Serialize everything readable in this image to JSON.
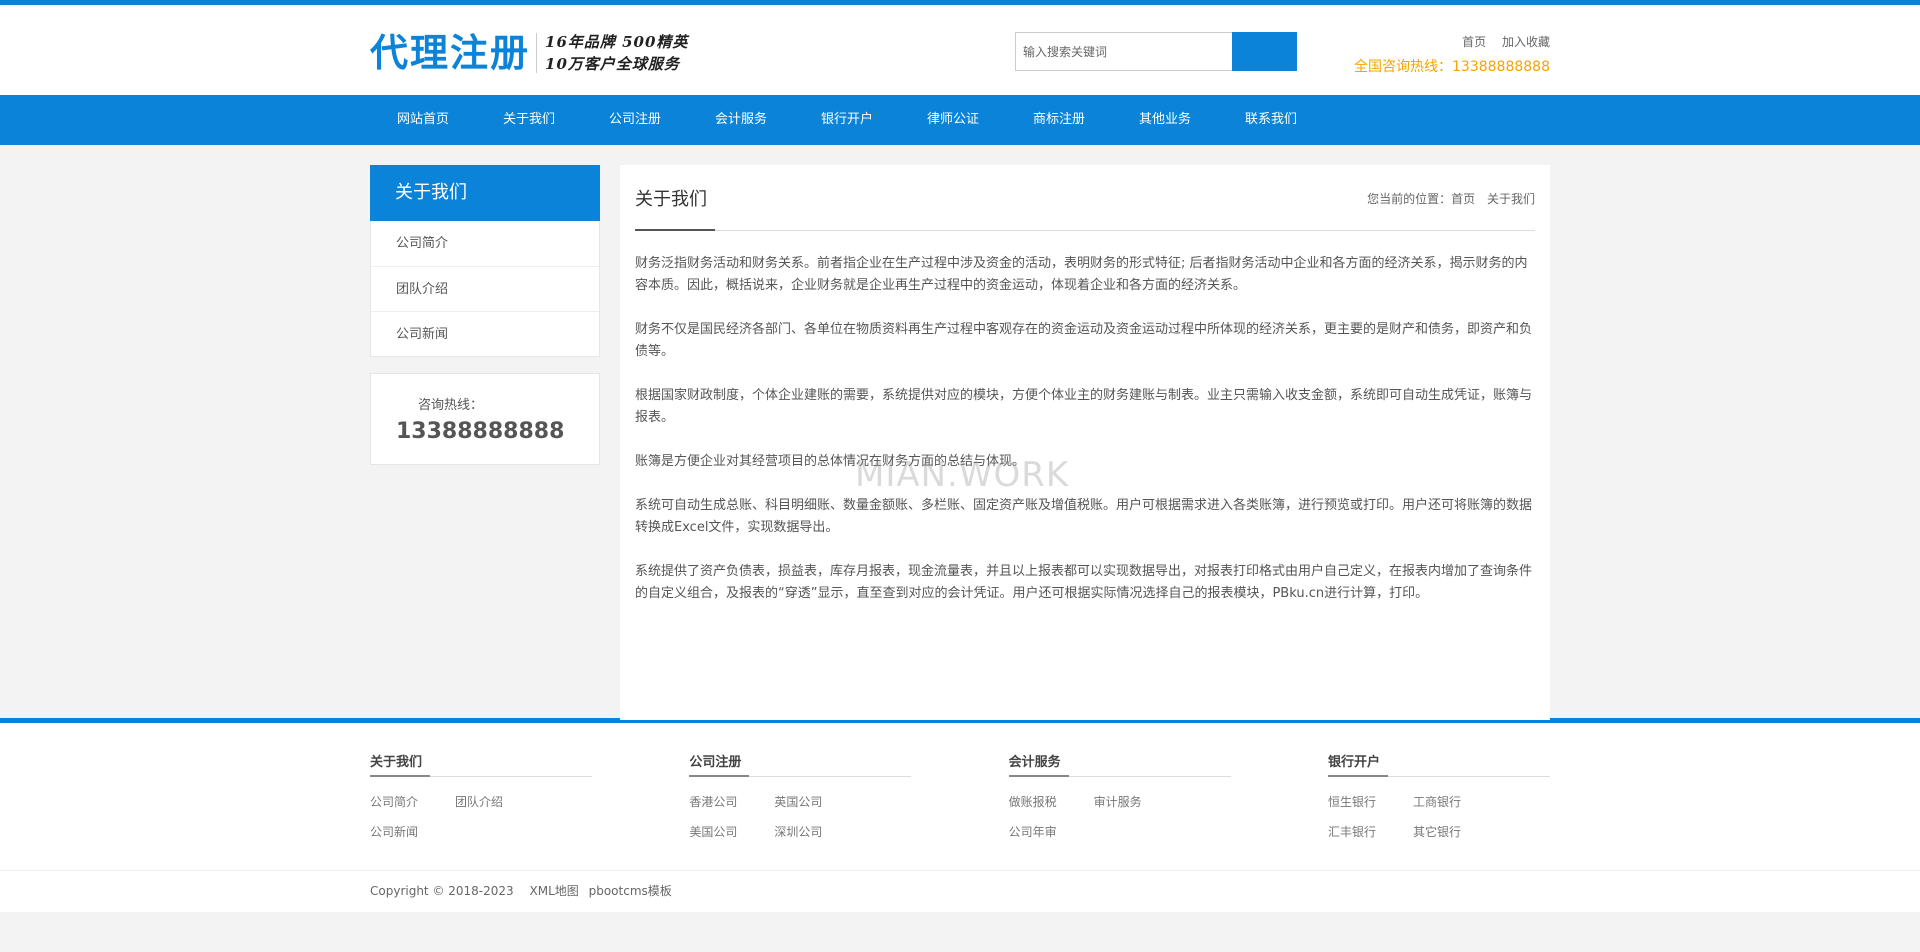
{
  "header": {
    "logo_text": "代理注册",
    "slogan_line1": "16年品牌 500精英",
    "slogan_line2": "10万客户全球服务",
    "search_placeholder": "输入搜索关键词",
    "links": [
      "首页",
      "加入收藏"
    ],
    "hotline": "全国咨询热线：13388888888"
  },
  "nav": {
    "items": [
      "网站首页",
      "关于我们",
      "公司注册",
      "会计服务",
      "银行开户",
      "律师公证",
      "商标注册",
      "其他业务",
      "联系我们"
    ]
  },
  "sidebar": {
    "title": "关于我们",
    "items": [
      "公司简介",
      "团队介绍",
      "公司新闻"
    ],
    "contact_label": "咨询热线：",
    "contact_phone": "13388888888"
  },
  "content": {
    "title": "关于我们",
    "breadcrumb_prefix": "您当前的位置：",
    "breadcrumb_home": "首页",
    "breadcrumb_current": "关于我们",
    "paragraphs": [
      "财务泛指财务活动和财务关系。前者指企业在生产过程中涉及资金的活动，表明财务的形式特征; 后者指财务活动中企业和各方面的经济关系，揭示财务的内容本质。因此，概括说来，企业财务就是企业再生产过程中的资金运动，体现着企业和各方面的经济关系。",
      "财务不仅是国民经济各部门、各单位在物质资料再生产过程中客观存在的资金运动及资金运动过程中所体现的经济关系，更主要的是财产和债务，即资产和负债等。",
      "根据国家财政制度，个体企业建账的需要，系统提供对应的模块，方便个体业主的财务建账与制表。业主只需输入收支金额，系统即可自动生成凭证，账簿与报表。",
      "账簿是方便企业对其经营项目的总体情况在财务方面的总结与体现。",
      "系统可自动生成总账、科目明细账、数量金额账、多栏账、固定资产账及增值税账。用户可根据需求进入各类账簿，进行预览或打印。用户还可将账簿的数据转换成Excel文件，实现数据导出。",
      "系统提供了资产负债表，损益表，库存月报表，现金流量表，并且以上报表都可以实现数据导出，对报表打印格式由用户自己定义，在报表内增加了查询条件的自定义组合，及报表的“穿透”显示，直至查到对应的会计凭证。用户还可根据实际情况选择自己的报表模块，PBku.cn进行计算，打印。"
    ],
    "watermark": "MIAN.WORK"
  },
  "footer": {
    "columns": [
      {
        "title": "关于我们",
        "links": [
          "公司简介",
          "团队介绍",
          "公司新闻"
        ]
      },
      {
        "title": "公司注册",
        "links": [
          "香港公司",
          "英国公司",
          "美国公司",
          "深圳公司"
        ]
      },
      {
        "title": "会计服务",
        "links": [
          "做账报税",
          "审计服务",
          "公司年审"
        ]
      },
      {
        "title": "银行开户",
        "links": [
          "恒生银行",
          "工商银行",
          "汇丰银行",
          "其它银行"
        ]
      }
    ],
    "copyright": "Copyright © 2018-2023",
    "sitemap": "XML地图",
    "template": "pbootcms模板"
  },
  "colors": {
    "primary": "#0a83d8",
    "hotline": "#f7a400"
  }
}
